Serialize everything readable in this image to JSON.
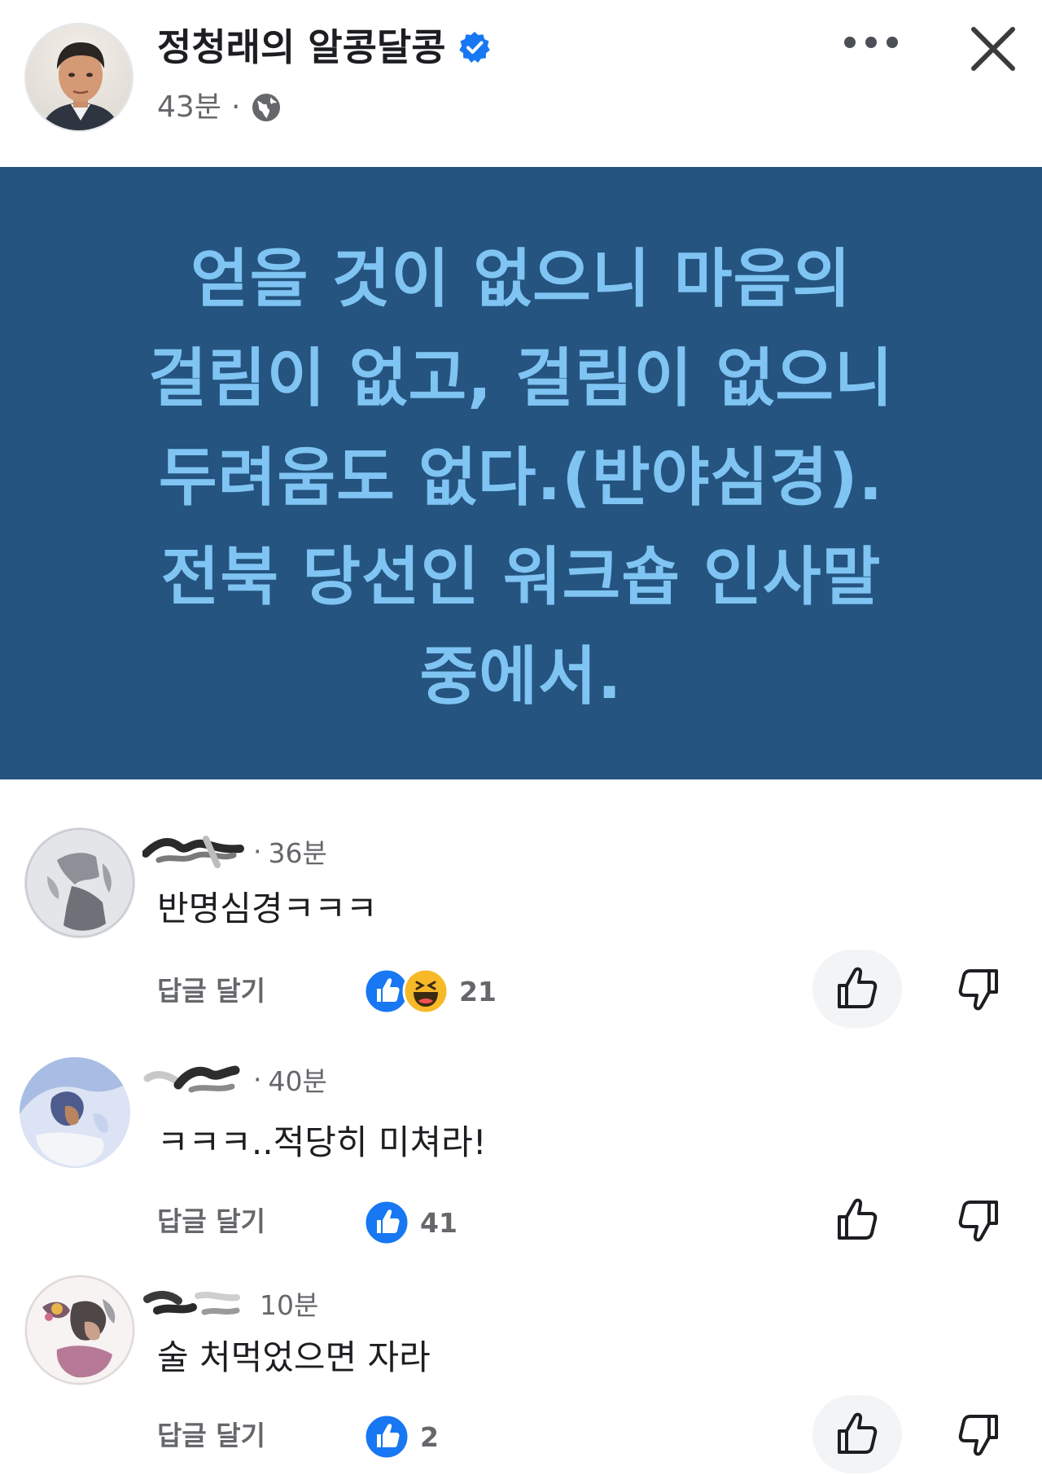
{
  "post": {
    "author": "정청래의 알콩달콩",
    "verified_icon": "verified-badge-icon",
    "time": "43분",
    "separator": "·",
    "audience_icon": "globe-icon",
    "more_icon": "more-horizontal-icon",
    "close_icon": "close-icon",
    "card_bg": "#24547f",
    "card_text_color": "#7fc4f3",
    "lines": [
      "얻을 것이 없으니 마음의",
      "걸림이 없고, 걸림이 없으니",
      "두려움도 없다.(반야심경).",
      "전북 당선인 워크숍 인사말",
      "중에서."
    ]
  },
  "comments": [
    {
      "time": "36분",
      "separator": "·",
      "text": "반명심경ㅋㅋㅋ",
      "reply_label": "답글 달기",
      "reaction_icons": [
        "like-reaction-icon",
        "haha-reaction-icon"
      ],
      "reaction_count": "21",
      "like_icon": "thumbs-up-icon",
      "dislike_icon": "thumbs-down-icon"
    },
    {
      "time": "40분",
      "separator": "·",
      "text": "ㅋㅋㅋ..적당히 미쳐라!",
      "reply_label": "답글 달기",
      "reaction_icons": [
        "like-reaction-icon"
      ],
      "reaction_count": "41",
      "like_icon": "thumbs-up-icon",
      "dislike_icon": "thumbs-down-icon"
    },
    {
      "time": "10분",
      "separator": "",
      "text": "술 처먹었으면 자라",
      "reply_label": "답글 달기",
      "reaction_icons": [
        "like-reaction-icon"
      ],
      "reaction_count": "2",
      "like_icon": "thumbs-up-icon",
      "dislike_icon": "thumbs-down-icon"
    }
  ],
  "colors": {
    "facebook_blue": "#1877f2",
    "secondary_text": "#65676b",
    "primary_text": "#1c1e21"
  }
}
